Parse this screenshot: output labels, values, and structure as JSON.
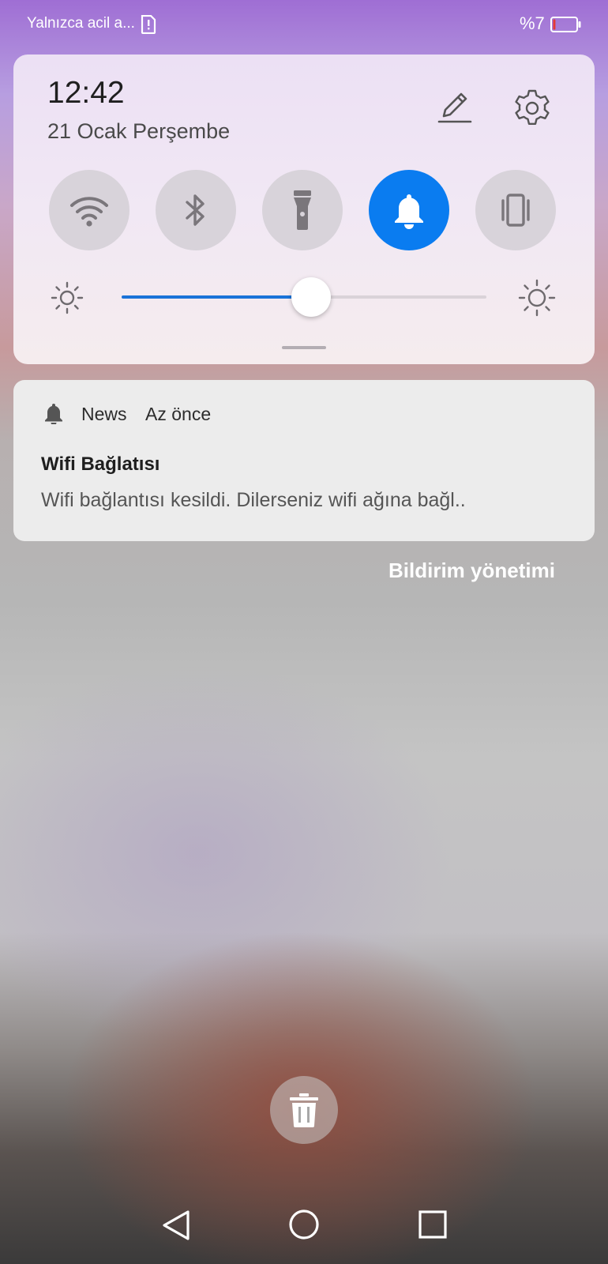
{
  "status_bar": {
    "carrier_text": "Yalnızca acil a...",
    "battery_percent": "%7",
    "battery_level": 0.07,
    "battery_color": "#e53935",
    "icons": [
      "sim-alert-icon",
      "battery-low-icon"
    ]
  },
  "quick_settings": {
    "time": "12:42",
    "date": "21 Ocak Perşembe",
    "header_icons": [
      "edit-pencil-icon",
      "gear-icon"
    ],
    "tiles": [
      {
        "icon": "wifi-icon",
        "active": false
      },
      {
        "icon": "bluetooth-icon",
        "active": false
      },
      {
        "icon": "flashlight-icon",
        "active": false
      },
      {
        "icon": "bell-icon",
        "active": true
      },
      {
        "icon": "vibrate-icon",
        "active": false
      }
    ],
    "active_color": "#0a7cf0",
    "brightness_level": 0.52,
    "brightness_color": "#1a73d8"
  },
  "notification": {
    "app_icon": "bell-icon",
    "app_name": "News",
    "time": "Az önce",
    "title": "Wifi Bağlatısı",
    "body": "Wifi bağlantısı kesildi. Dilerseniz wifi ağına bağl.."
  },
  "manage_notifications_label": "Bildirim yönetimi",
  "clear_all_icon": "trash-icon",
  "nav_bar": {
    "icons": [
      "back-icon",
      "home-icon",
      "recent-apps-icon"
    ]
  }
}
